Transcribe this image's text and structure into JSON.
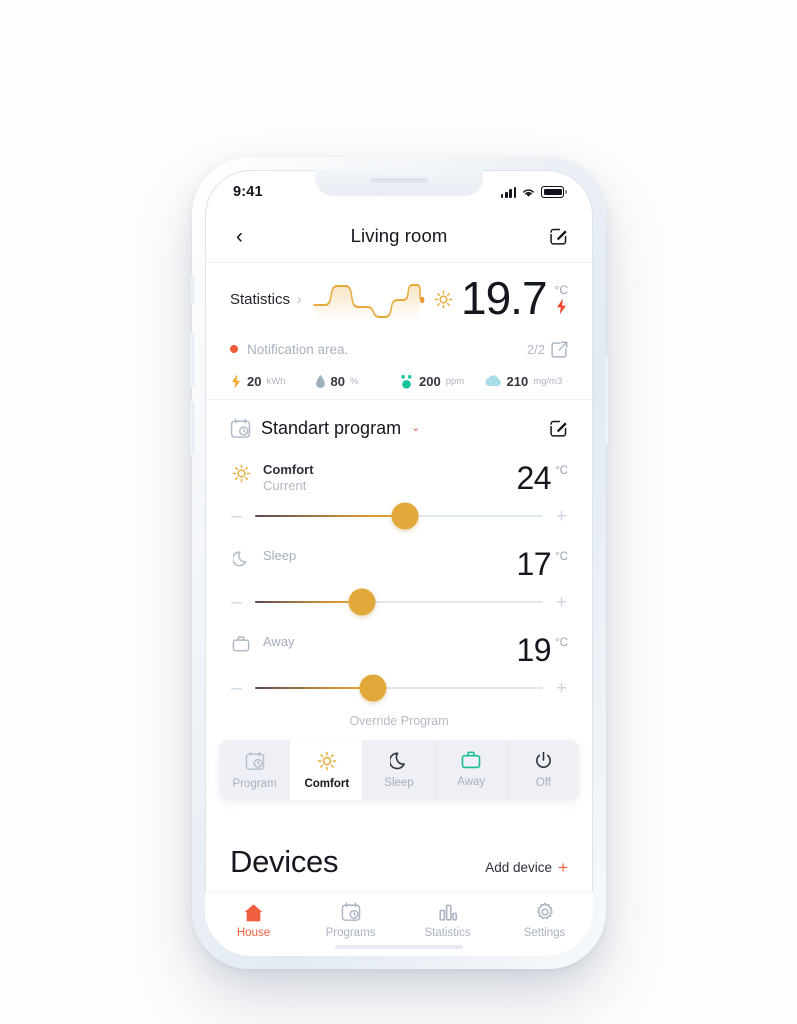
{
  "status_bar": {
    "time": "9:41",
    "signal": "signal-bars",
    "wifi": "wifi-icon",
    "battery": "battery-icon"
  },
  "header": {
    "back": "‹",
    "title": "Living room",
    "edit_icon": "edit-square-icon"
  },
  "statistics": {
    "link_label": "Statistics",
    "chevron": "›",
    "sun_icon": "sun-icon",
    "temperature": "19.7",
    "unit": "°C",
    "bolt_icon": "lightning-bolt-icon",
    "notification": {
      "text": "Notification area.",
      "count": "2/2",
      "link_icon": "external-link-icon",
      "dot_color": "#f05a3c"
    },
    "metrics": [
      {
        "icon": "bolt-icon",
        "value": "20",
        "unit": "kWh",
        "color": "#f0a830"
      },
      {
        "icon": "droplet-icon",
        "value": "80",
        "unit": "%",
        "color": "#9fb0bd"
      },
      {
        "icon": "co2-icon",
        "value": "200",
        "unit": "ppm",
        "color": "#17c39a"
      },
      {
        "icon": "cloud-icon",
        "value": "210",
        "unit": "mg/m3",
        "color": "#a8dcea"
      }
    ]
  },
  "program": {
    "icon": "calendar-clock-icon",
    "name": "Standart program",
    "caret": "⌄",
    "edit_icon": "edit-square-icon",
    "modes": [
      {
        "icon": "sun-icon",
        "name": "Comfort",
        "sub": "Current",
        "value": "24",
        "unit": "°C",
        "knob_percent": 52
      },
      {
        "icon": "moon-icon",
        "name": "Sleep",
        "sub": "",
        "value": "17",
        "unit": "°C",
        "knob_percent": 37
      },
      {
        "icon": "briefcase-icon",
        "name": "Away",
        "sub": "",
        "value": "19",
        "unit": "°C",
        "knob_percent": 41
      }
    ],
    "minus": "–",
    "plus": "+"
  },
  "override": {
    "label": "Override Program",
    "items": [
      {
        "icon": "calendar-clock-icon",
        "label": "Program",
        "active": false
      },
      {
        "icon": "sun-icon",
        "label": "Comfort",
        "active": true
      },
      {
        "icon": "moon-icon",
        "label": "Sleep",
        "active": false
      },
      {
        "icon": "briefcase-icon",
        "label": "Away",
        "active": false
      },
      {
        "icon": "power-icon",
        "label": "Off",
        "active": false
      }
    ]
  },
  "devices": {
    "title": "Devices",
    "add_label": "Add device",
    "add_icon": "plus-icon"
  },
  "tabbar": {
    "items": [
      {
        "icon": "home-icon",
        "label": "House",
        "active": true
      },
      {
        "icon": "calendar-clock-icon",
        "label": "Programs",
        "active": false
      },
      {
        "icon": "bar-chart-icon",
        "label": "Statistics",
        "active": false
      },
      {
        "icon": "gear-icon",
        "label": "Settings",
        "active": false
      }
    ]
  },
  "colors": {
    "accent_orange": "#e2a93a",
    "accent_red": "#ef5f3d",
    "green": "#17c39a"
  }
}
